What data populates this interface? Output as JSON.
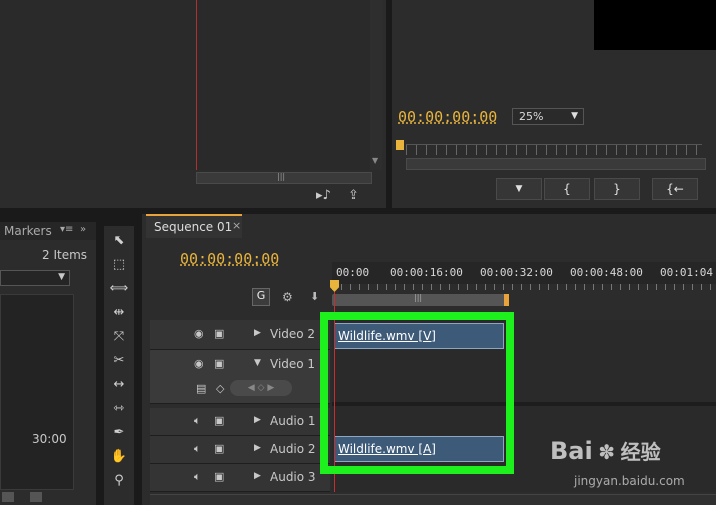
{
  "program_monitor": {
    "timecode": "00:00:00:00",
    "zoom": "25%",
    "buttons": [
      "▼",
      "{",
      "}",
      "{←"
    ]
  },
  "project_panel": {
    "tab_label": "Markers",
    "items_count": "2 Items",
    "duration": "30:00"
  },
  "sequence": {
    "tab_label": "Sequence 01",
    "close_glyph": "×",
    "timecode": "00:00:00:00",
    "ruler_labels": [
      "00:00",
      "00:00:16:00",
      "00:00:32:00",
      "00:00:48:00",
      "00:01:04"
    ],
    "tracks": [
      {
        "name": "Video 2"
      },
      {
        "name": "Video 1"
      },
      {
        "name": "Audio 1"
      },
      {
        "name": "Audio 2"
      },
      {
        "name": "Audio 3"
      }
    ],
    "clips": {
      "video": "Wildlife.wmv [V]",
      "audio": "Wildlife.wmv [A]"
    }
  },
  "watermark": {
    "brand": "Bai",
    "brand_cn": "经验",
    "url": "jingyan.baidu.com"
  },
  "colors": {
    "highlight": "#1ef01e",
    "timecode": "#e8b43c",
    "playhead": "#c43030",
    "clip": "#3d5a78"
  }
}
